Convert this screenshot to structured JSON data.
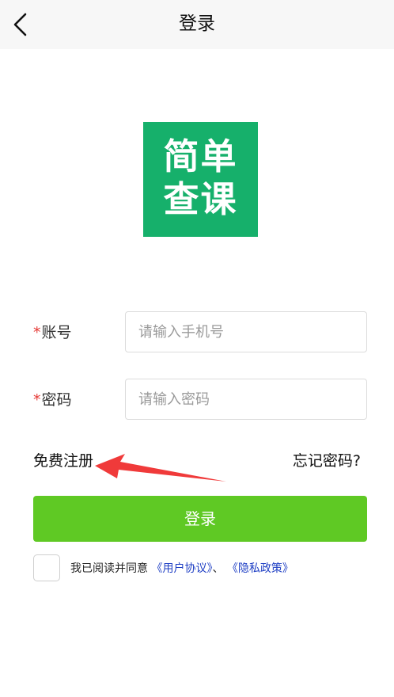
{
  "header": {
    "title": "登录"
  },
  "logo": {
    "line1": "简单",
    "line2": "查课",
    "color": "#16b06b"
  },
  "form": {
    "account": {
      "required_mark": "*",
      "label": "账号",
      "placeholder": "请输入手机号",
      "value": ""
    },
    "password": {
      "required_mark": "*",
      "label": "密码",
      "placeholder": "请输入密码",
      "value": ""
    }
  },
  "links": {
    "register": "免费注册",
    "forgot_password": "忘记密码?"
  },
  "login_button": {
    "label": "登录",
    "color": "#5fc924"
  },
  "agreement": {
    "checked": false,
    "prefix": "我已阅读并同意",
    "user_agreement": "《用户协议》",
    "separator": "、",
    "privacy_policy": "《隐私政策》",
    "link_color": "#1f3fc4"
  },
  "annotation": {
    "arrow_icon": "red-arrow-icon",
    "arrow_color": "#f03a3a"
  }
}
